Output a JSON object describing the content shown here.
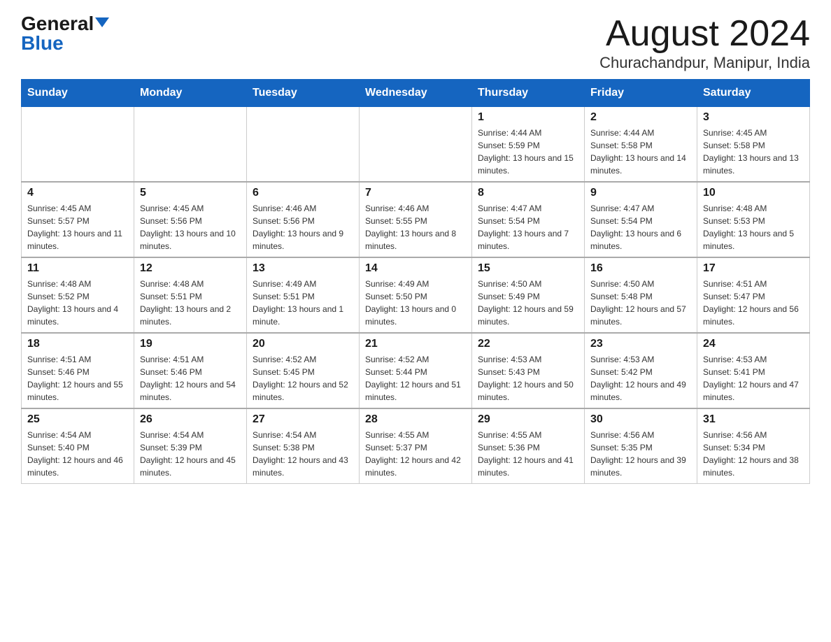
{
  "header": {
    "logo_general": "General",
    "logo_blue": "Blue",
    "month_title": "August 2024",
    "location": "Churachandpur, Manipur, India"
  },
  "weekdays": [
    "Sunday",
    "Monday",
    "Tuesday",
    "Wednesday",
    "Thursday",
    "Friday",
    "Saturday"
  ],
  "weeks": [
    [
      {
        "day": "",
        "sunrise": "",
        "sunset": "",
        "daylight": ""
      },
      {
        "day": "",
        "sunrise": "",
        "sunset": "",
        "daylight": ""
      },
      {
        "day": "",
        "sunrise": "",
        "sunset": "",
        "daylight": ""
      },
      {
        "day": "",
        "sunrise": "",
        "sunset": "",
        "daylight": ""
      },
      {
        "day": "1",
        "sunrise": "Sunrise: 4:44 AM",
        "sunset": "Sunset: 5:59 PM",
        "daylight": "Daylight: 13 hours and 15 minutes."
      },
      {
        "day": "2",
        "sunrise": "Sunrise: 4:44 AM",
        "sunset": "Sunset: 5:58 PM",
        "daylight": "Daylight: 13 hours and 14 minutes."
      },
      {
        "day": "3",
        "sunrise": "Sunrise: 4:45 AM",
        "sunset": "Sunset: 5:58 PM",
        "daylight": "Daylight: 13 hours and 13 minutes."
      }
    ],
    [
      {
        "day": "4",
        "sunrise": "Sunrise: 4:45 AM",
        "sunset": "Sunset: 5:57 PM",
        "daylight": "Daylight: 13 hours and 11 minutes."
      },
      {
        "day": "5",
        "sunrise": "Sunrise: 4:45 AM",
        "sunset": "Sunset: 5:56 PM",
        "daylight": "Daylight: 13 hours and 10 minutes."
      },
      {
        "day": "6",
        "sunrise": "Sunrise: 4:46 AM",
        "sunset": "Sunset: 5:56 PM",
        "daylight": "Daylight: 13 hours and 9 minutes."
      },
      {
        "day": "7",
        "sunrise": "Sunrise: 4:46 AM",
        "sunset": "Sunset: 5:55 PM",
        "daylight": "Daylight: 13 hours and 8 minutes."
      },
      {
        "day": "8",
        "sunrise": "Sunrise: 4:47 AM",
        "sunset": "Sunset: 5:54 PM",
        "daylight": "Daylight: 13 hours and 7 minutes."
      },
      {
        "day": "9",
        "sunrise": "Sunrise: 4:47 AM",
        "sunset": "Sunset: 5:54 PM",
        "daylight": "Daylight: 13 hours and 6 minutes."
      },
      {
        "day": "10",
        "sunrise": "Sunrise: 4:48 AM",
        "sunset": "Sunset: 5:53 PM",
        "daylight": "Daylight: 13 hours and 5 minutes."
      }
    ],
    [
      {
        "day": "11",
        "sunrise": "Sunrise: 4:48 AM",
        "sunset": "Sunset: 5:52 PM",
        "daylight": "Daylight: 13 hours and 4 minutes."
      },
      {
        "day": "12",
        "sunrise": "Sunrise: 4:48 AM",
        "sunset": "Sunset: 5:51 PM",
        "daylight": "Daylight: 13 hours and 2 minutes."
      },
      {
        "day": "13",
        "sunrise": "Sunrise: 4:49 AM",
        "sunset": "Sunset: 5:51 PM",
        "daylight": "Daylight: 13 hours and 1 minute."
      },
      {
        "day": "14",
        "sunrise": "Sunrise: 4:49 AM",
        "sunset": "Sunset: 5:50 PM",
        "daylight": "Daylight: 13 hours and 0 minutes."
      },
      {
        "day": "15",
        "sunrise": "Sunrise: 4:50 AM",
        "sunset": "Sunset: 5:49 PM",
        "daylight": "Daylight: 12 hours and 59 minutes."
      },
      {
        "day": "16",
        "sunrise": "Sunrise: 4:50 AM",
        "sunset": "Sunset: 5:48 PM",
        "daylight": "Daylight: 12 hours and 57 minutes."
      },
      {
        "day": "17",
        "sunrise": "Sunrise: 4:51 AM",
        "sunset": "Sunset: 5:47 PM",
        "daylight": "Daylight: 12 hours and 56 minutes."
      }
    ],
    [
      {
        "day": "18",
        "sunrise": "Sunrise: 4:51 AM",
        "sunset": "Sunset: 5:46 PM",
        "daylight": "Daylight: 12 hours and 55 minutes."
      },
      {
        "day": "19",
        "sunrise": "Sunrise: 4:51 AM",
        "sunset": "Sunset: 5:46 PM",
        "daylight": "Daylight: 12 hours and 54 minutes."
      },
      {
        "day": "20",
        "sunrise": "Sunrise: 4:52 AM",
        "sunset": "Sunset: 5:45 PM",
        "daylight": "Daylight: 12 hours and 52 minutes."
      },
      {
        "day": "21",
        "sunrise": "Sunrise: 4:52 AM",
        "sunset": "Sunset: 5:44 PM",
        "daylight": "Daylight: 12 hours and 51 minutes."
      },
      {
        "day": "22",
        "sunrise": "Sunrise: 4:53 AM",
        "sunset": "Sunset: 5:43 PM",
        "daylight": "Daylight: 12 hours and 50 minutes."
      },
      {
        "day": "23",
        "sunrise": "Sunrise: 4:53 AM",
        "sunset": "Sunset: 5:42 PM",
        "daylight": "Daylight: 12 hours and 49 minutes."
      },
      {
        "day": "24",
        "sunrise": "Sunrise: 4:53 AM",
        "sunset": "Sunset: 5:41 PM",
        "daylight": "Daylight: 12 hours and 47 minutes."
      }
    ],
    [
      {
        "day": "25",
        "sunrise": "Sunrise: 4:54 AM",
        "sunset": "Sunset: 5:40 PM",
        "daylight": "Daylight: 12 hours and 46 minutes."
      },
      {
        "day": "26",
        "sunrise": "Sunrise: 4:54 AM",
        "sunset": "Sunset: 5:39 PM",
        "daylight": "Daylight: 12 hours and 45 minutes."
      },
      {
        "day": "27",
        "sunrise": "Sunrise: 4:54 AM",
        "sunset": "Sunset: 5:38 PM",
        "daylight": "Daylight: 12 hours and 43 minutes."
      },
      {
        "day": "28",
        "sunrise": "Sunrise: 4:55 AM",
        "sunset": "Sunset: 5:37 PM",
        "daylight": "Daylight: 12 hours and 42 minutes."
      },
      {
        "day": "29",
        "sunrise": "Sunrise: 4:55 AM",
        "sunset": "Sunset: 5:36 PM",
        "daylight": "Daylight: 12 hours and 41 minutes."
      },
      {
        "day": "30",
        "sunrise": "Sunrise: 4:56 AM",
        "sunset": "Sunset: 5:35 PM",
        "daylight": "Daylight: 12 hours and 39 minutes."
      },
      {
        "day": "31",
        "sunrise": "Sunrise: 4:56 AM",
        "sunset": "Sunset: 5:34 PM",
        "daylight": "Daylight: 12 hours and 38 minutes."
      }
    ]
  ]
}
